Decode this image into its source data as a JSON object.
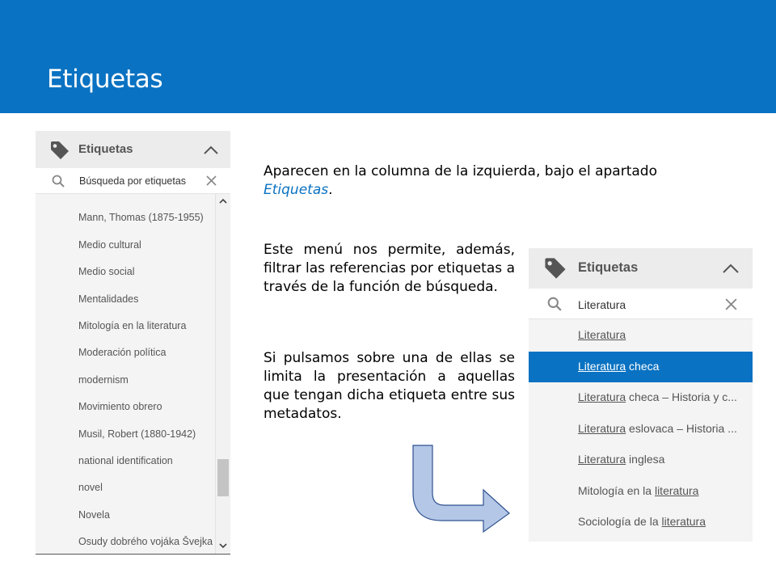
{
  "slide": {
    "title": "Etiquetas",
    "intro_text": "Aparecen en la columna de la izquierda, bajo el apartado ",
    "intro_emphasis": "Etiquetas",
    "intro_end": ".",
    "paragraph_1": "Este menú nos permite, además, filtrar las referencias por etiquetas a través de la función de búsqueda.",
    "paragraph_2": "Si pulsamos sobre una de ellas se limita la presentación a aquellas que tengan dicha etiqueta entre sus metadatos."
  },
  "panel_left": {
    "header_label": "Etiquetas",
    "search_value": "Búsqueda por etiquetas",
    "items": [
      "Mann, Thomas (1875-1955)",
      "Medio cultural",
      "Medio social",
      "Mentalidades",
      "Mitología en la literatura",
      "Moderación política",
      "modernism",
      "Movimiento obrero",
      "Musil, Robert (1880-1942)",
      "national identification",
      "novel",
      "Novela",
      "Osudy dobrého vojáka Švejka"
    ]
  },
  "panel_right": {
    "header_label": "Etiquetas",
    "search_value": "Literatura",
    "items": [
      {
        "pre": "",
        "match": "Literatura",
        "post": ""
      },
      {
        "pre": "",
        "match": "Literatura",
        "post": " checa",
        "selected": true
      },
      {
        "pre": "",
        "match": "Literatura",
        "post": " checa – Historia y c..."
      },
      {
        "pre": "",
        "match": "Literatura",
        "post": " eslovaca – Historia ..."
      },
      {
        "pre": "",
        "match": "Literatura",
        "post": " inglesa"
      },
      {
        "pre": "Mitología en la ",
        "match": "literatura",
        "post": ""
      },
      {
        "pre": "Sociología de la ",
        "match": "literatura",
        "post": ""
      }
    ]
  },
  "colors": {
    "accent": "#0a72c2",
    "arrow_fill": "#b4c7e7",
    "arrow_stroke": "#2f528f"
  },
  "icons": {
    "tag": "tag-icon",
    "search": "search-icon",
    "clear": "close-icon",
    "collapse": "chevron-up-icon",
    "flow": "bent-arrow-icon"
  }
}
